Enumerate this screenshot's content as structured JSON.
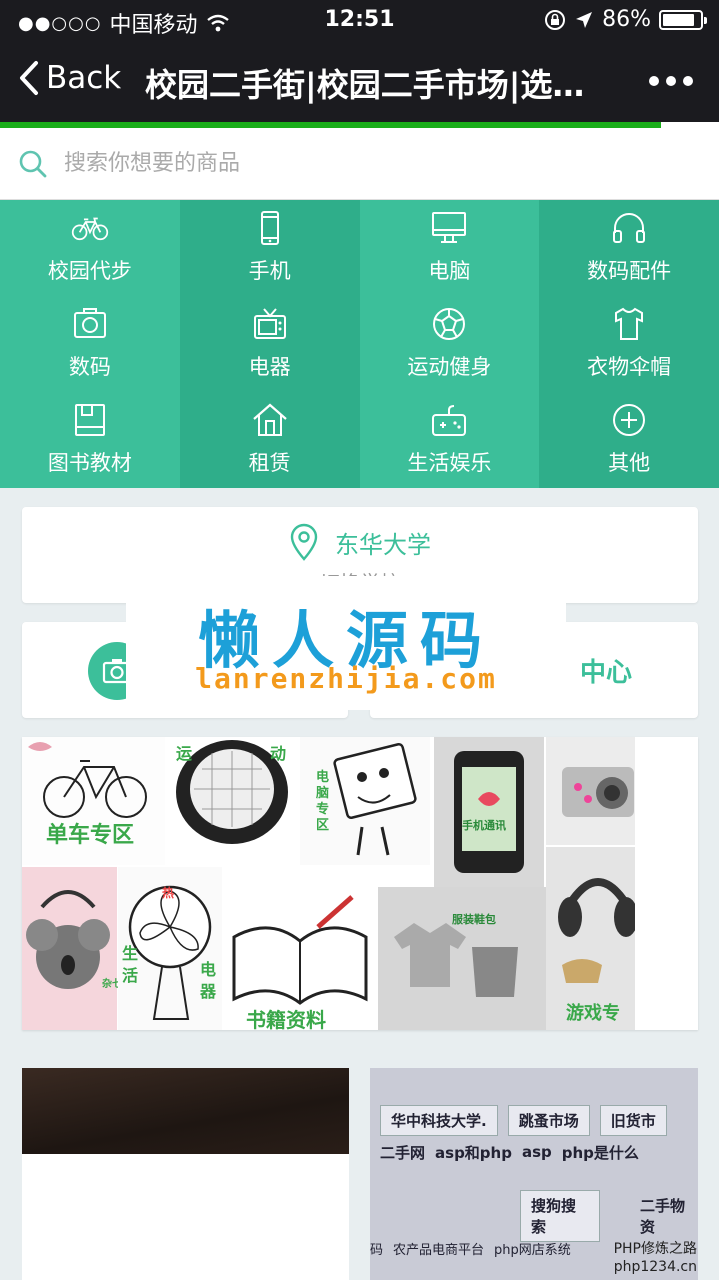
{
  "status_bar": {
    "carrier": "中国移动",
    "signal": "●●○○○",
    "time": "12:51",
    "battery": "86%",
    "battery_level": 0.86
  },
  "nav": {
    "back_label": "Back",
    "title": "校园二手街|校园二手市场|选…",
    "page_load_progress": 0.92
  },
  "search": {
    "placeholder": "搜索你想要的商品"
  },
  "categories": [
    {
      "label": "校园代步",
      "icon": "bicycle-icon"
    },
    {
      "label": "手机",
      "icon": "phone-icon"
    },
    {
      "label": "电脑",
      "icon": "monitor-icon"
    },
    {
      "label": "数码配件",
      "icon": "headphones-icon"
    },
    {
      "label": "数码",
      "icon": "camera-icon"
    },
    {
      "label": "电器",
      "icon": "tv-icon"
    },
    {
      "label": "运动健身",
      "icon": "ball-icon"
    },
    {
      "label": "衣物伞帽",
      "icon": "shirt-icon"
    },
    {
      "label": "图书教材",
      "icon": "book-icon"
    },
    {
      "label": "租赁",
      "icon": "house-icon"
    },
    {
      "label": "生活娱乐",
      "icon": "gamepad-icon"
    },
    {
      "label": "其他",
      "icon": "plus-circle-icon"
    }
  ],
  "location": {
    "school": "东华大学",
    "switch_label": "切换学校"
  },
  "actions": {
    "right_label": "中心"
  },
  "watermark": {
    "title": "懒人源码",
    "url": "lanrenzhijia.com"
  },
  "banner": {
    "tiles": [
      "单车专区",
      "运",
      "动",
      "电",
      "脑",
      "专",
      "区",
      "手机通讯",
      "书籍资料",
      "生",
      "活",
      "电",
      "器",
      "杂七杂八",
      "服装鞋包",
      "游戏专",
      "热"
    ]
  },
  "products": {
    "right_rows": [
      [
        "华中科技大学.",
        "跳蚤市场",
        "旧货市"
      ],
      [
        "二手网",
        "asp和php",
        "asp",
        "php是什么"
      ],
      [
        "搜狗搜索",
        "二手物资"
      ],
      [
        "码",
        "农产品电商平台",
        "php网店系统"
      ]
    ]
  },
  "footer_watermark": {
    "line1": "PHP修炼之路",
    "line2": "php1234.cn"
  },
  "colors": {
    "accent": "#3cbf9a",
    "accent_dark": "#2fae8a",
    "navbar": "#1b1b1f",
    "progress": "#1aad19"
  }
}
